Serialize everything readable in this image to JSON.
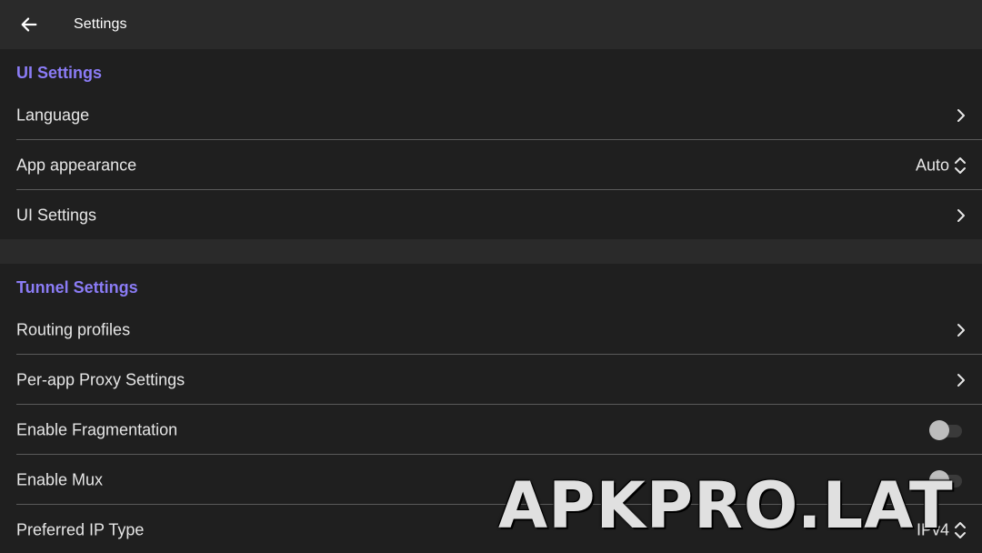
{
  "header": {
    "title": "Settings",
    "back_icon": "arrow-left-icon"
  },
  "colors": {
    "accent": "#8b7cf6",
    "background": "#1f1f1f",
    "toolbar": "#2a2a2a",
    "divider": "#5a5a5a"
  },
  "ui_settings": {
    "header": "UI Settings",
    "language_label": "Language",
    "app_appearance_label": "App appearance",
    "app_appearance_value": "Auto",
    "ui_settings_label": "UI Settings"
  },
  "tunnel_settings": {
    "header": "Tunnel Settings",
    "routing_profiles_label": "Routing profiles",
    "per_app_proxy_label": "Per-app Proxy Settings",
    "enable_fragmentation_label": "Enable Fragmentation",
    "enable_fragmentation_on": false,
    "enable_mux_label": "Enable Mux",
    "enable_mux_on": false,
    "preferred_ip_type_label": "Preferred IP Type",
    "preferred_ip_type_value": "IPv4"
  },
  "watermark": "APKPRO.LAT"
}
